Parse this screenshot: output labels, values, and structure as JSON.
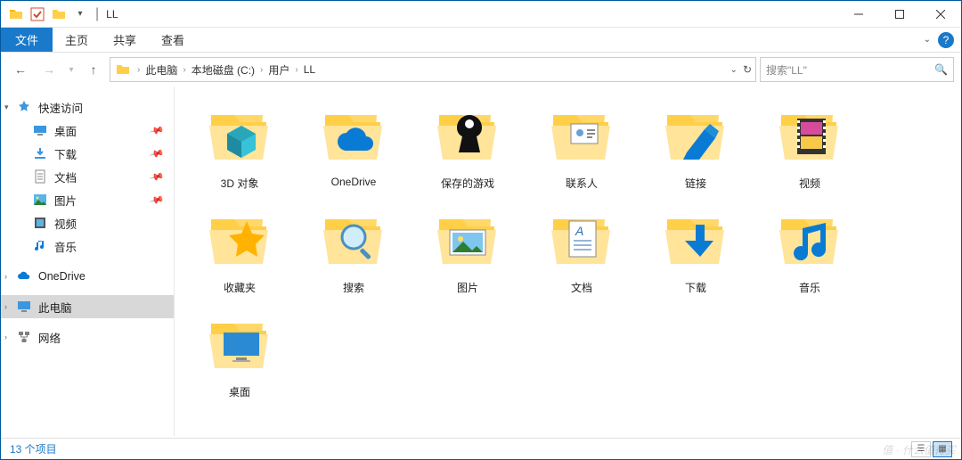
{
  "window": {
    "title": "LL",
    "divider": "|"
  },
  "ribbon": {
    "file": "文件",
    "tabs": [
      "主页",
      "共享",
      "查看"
    ]
  },
  "nav": {
    "back_label": "后退",
    "forward_label": "前进",
    "up_label": "上一级"
  },
  "breadcrumb": {
    "items": [
      "此电脑",
      "本地磁盘 (C:)",
      "用户",
      "LL"
    ]
  },
  "search": {
    "placeholder": "搜索\"LL\""
  },
  "sidebar": {
    "quick_access": "快速访问",
    "quick_items": [
      {
        "label": "桌面",
        "icon": "desktop",
        "pinned": true
      },
      {
        "label": "下载",
        "icon": "download",
        "pinned": true
      },
      {
        "label": "文档",
        "icon": "document",
        "pinned": true
      },
      {
        "label": "图片",
        "icon": "picture",
        "pinned": true
      },
      {
        "label": "视频",
        "icon": "video",
        "pinned": false
      },
      {
        "label": "音乐",
        "icon": "music",
        "pinned": false
      }
    ],
    "onedrive": "OneDrive",
    "this_pc": "此电脑",
    "network": "网络"
  },
  "folders": [
    {
      "label": "3D 对象",
      "overlay": "cube"
    },
    {
      "label": "OneDrive",
      "overlay": "cloud"
    },
    {
      "label": "保存的游戏",
      "overlay": "chess"
    },
    {
      "label": "联系人",
      "overlay": "contact"
    },
    {
      "label": "链接",
      "overlay": "link"
    },
    {
      "label": "视频",
      "overlay": "film"
    },
    {
      "label": "收藏夹",
      "overlay": "star"
    },
    {
      "label": "搜索",
      "overlay": "search"
    },
    {
      "label": "图片",
      "overlay": "picture"
    },
    {
      "label": "文档",
      "overlay": "document"
    },
    {
      "label": "下载",
      "overlay": "download"
    },
    {
      "label": "音乐",
      "overlay": "music"
    },
    {
      "label": "桌面",
      "overlay": "desktop"
    }
  ],
  "status": {
    "count_text": "13 个项目"
  },
  "watermark": "值 · 什么值得买"
}
